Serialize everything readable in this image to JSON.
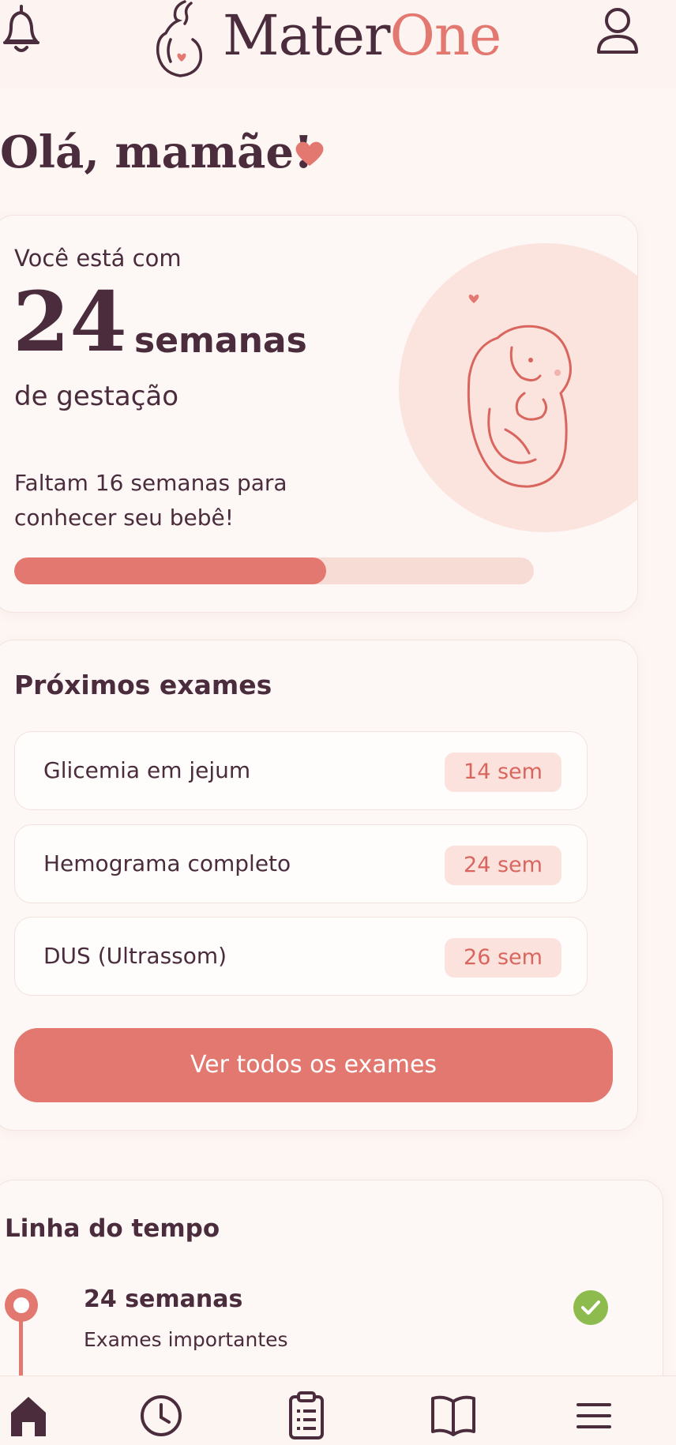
{
  "header": {
    "brand_part1": "Mater",
    "brand_part2": "One",
    "icons": [
      "bell-icon",
      "logo-pregnant-mother-icon",
      "user-icon"
    ]
  },
  "greeting": "Olá, mamãe!",
  "pregnancy": {
    "intro": "Você está com",
    "weeks": "24",
    "unit": "semanas",
    "sub": "de gestação",
    "remaining": "Faltam 16 semanas para conhecer seu bebê!",
    "progress_fraction": 0.6
  },
  "exams": {
    "title": "Próximos exames",
    "items": [
      {
        "name": "Glicemia em jejum",
        "badge": "14 sem"
      },
      {
        "name": "Hemograma completo",
        "badge": "24 sem"
      },
      {
        "name": "DUS (Ultrassom)",
        "badge": "26 sem"
      }
    ],
    "all_button": "Ver todos os exames"
  },
  "timeline": {
    "title": "Linha do tempo",
    "items": [
      {
        "week": "24 semanas",
        "desc": "Exames importantes",
        "status": "done"
      }
    ]
  },
  "nav": [
    "home-icon",
    "clock-icon",
    "clipboard-icon",
    "book-icon",
    "menu-icon"
  ],
  "colors": {
    "accent": "#e2786f",
    "text": "#4a2c3c",
    "background": "#fdf6f3",
    "badge_bg": "#fbe2dd",
    "check": "#8dbb4e"
  }
}
